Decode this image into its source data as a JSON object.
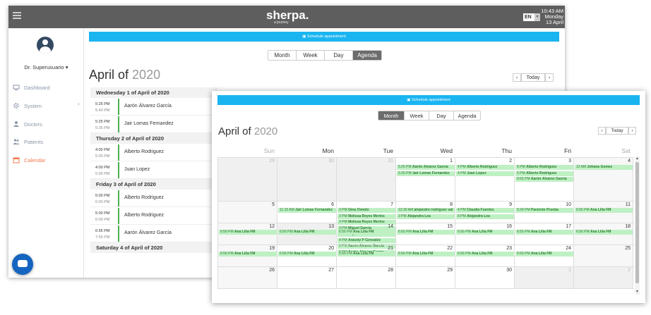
{
  "header": {
    "logo": "sherpa.",
    "logo_sub": "a journey",
    "language": "EN",
    "time": "10:43 AM",
    "weekday": "Monday",
    "date": "13 April"
  },
  "user": {
    "name": "Dr. Superusuario"
  },
  "sidebar": {
    "items": [
      {
        "label": "Dashboard",
        "icon": "monitor-icon"
      },
      {
        "label": "System",
        "icon": "gear-icon"
      },
      {
        "label": "Doctors",
        "icon": "user-icon"
      },
      {
        "label": "Patients",
        "icon": "users-icon"
      },
      {
        "label": "Calendar",
        "icon": "calendar-icon",
        "active": true
      }
    ]
  },
  "toolbar": {
    "schedule_label": "Schedule appointment",
    "views": [
      "Month",
      "Week",
      "Day",
      "Agenda"
    ],
    "today_label": "Today",
    "prev": "‹",
    "next": "›"
  },
  "back_window": {
    "selected_view": "Agenda",
    "title_month": "April of",
    "title_year": "2020",
    "agenda": [
      {
        "day": "Wednesday 1 of April of 2020",
        "rows": [
          {
            "start": "5:25 PM",
            "end": "5:40 PM",
            "name": "Aarón Álvarez García"
          },
          {
            "start": "5:25 PM",
            "end": "5:35 PM",
            "name": "Jair Lomas Fernandez"
          }
        ]
      },
      {
        "day": "Thursday 2 of April of 2020",
        "rows": [
          {
            "start": "4:00 PM",
            "end": "5:00 PM",
            "name": "Alberto Rodriguez"
          },
          {
            "start": "4:00 PM",
            "end": "5:00 PM",
            "name": "Juan Lopez"
          }
        ]
      },
      {
        "day": "Friday 3 of April of 2020",
        "rows": [
          {
            "start": "5:00 PM",
            "end": "6:00 PM",
            "name": "Alberto Rodriguez"
          },
          {
            "start": "5:00 PM",
            "end": "6:00 PM",
            "name": "Alberto Rodriguez"
          },
          {
            "start": "6:55 PM",
            "end": "7:55 PM",
            "name": "Aarón Álvarez García"
          }
        ]
      },
      {
        "day": "Saturday 4 of April of 2020",
        "rows": []
      }
    ]
  },
  "front_window": {
    "selected_view": "Month",
    "title_month": "April of",
    "title_year": "2020",
    "weekdays": [
      "Sun",
      "Mon",
      "Tue",
      "Wed",
      "Thu",
      "Fri",
      "Sat"
    ],
    "weeks": [
      {
        "days": [
          {
            "n": "29",
            "other": true,
            "events": []
          },
          {
            "n": "30",
            "other": true,
            "events": []
          },
          {
            "n": "31",
            "other": true,
            "events": []
          },
          {
            "n": "1",
            "events": [
              {
                "t": "5:25 PM",
                "name": "Aarón Álvarez García"
              },
              {
                "t": "5:25 PM",
                "name": "Jair Lomas Fernandez"
              }
            ]
          },
          {
            "n": "2",
            "events": [
              {
                "t": "4 PM",
                "name": "Alberto Rodriguez"
              },
              {
                "t": "4 PM",
                "name": "Juan Lopez"
              }
            ]
          },
          {
            "n": "3",
            "events": [
              {
                "t": "5 PM",
                "name": "Alberto Rodriguez"
              },
              {
                "t": "5 PM",
                "name": "Alberto Rodriguez"
              },
              {
                "t": "6:55 PM",
                "name": "Aarón Álvarez García"
              }
            ]
          },
          {
            "n": "4",
            "events": [
              {
                "t": "12 AM",
                "name": "Johana Gomez"
              }
            ]
          }
        ]
      },
      {
        "days": [
          {
            "n": "5",
            "events": []
          },
          {
            "n": "6",
            "events": [
              {
                "t": "11:15 AM",
                "name": "Jair Lomas Fernandez"
              }
            ]
          },
          {
            "n": "7",
            "events": [
              {
                "t": "3 PM",
                "name": "Gina Oviedo"
              },
              {
                "t": "3 PM",
                "name": "Melissa Reyes Merlos"
              },
              {
                "t": "3 PM",
                "name": "Melissa Reyes Merlos"
              },
              {
                "t": "3 PM",
                "name": "Miguel García"
              },
              {
                "t": "3 PM",
                "name": "Miguel García"
              },
              {
                "t": "4 PM",
                "name": "Aracely P Gonzalez"
              },
              {
                "t": "9 PM",
                "name": "Aarón Álvarez García"
              },
              {
                "t": "9 PM",
                "name": "Aarón Álvarez García"
              }
            ]
          },
          {
            "n": "8",
            "events": [
              {
                "t": "12:30 AM",
                "name": "alejandro rodriguez val"
              },
              {
                "t": "3 PM",
                "name": "Alejandra Lea"
              }
            ]
          },
          {
            "n": "9",
            "events": [
              {
                "t": "4 PM",
                "name": "Claudia Fuentes"
              },
              {
                "t": "8 PM",
                "name": "Alejandra Lea"
              }
            ]
          },
          {
            "n": "10",
            "events": [
              {
                "t": "5:34 PM",
                "name": "Paciente Prueba"
              }
            ]
          },
          {
            "n": "11",
            "events": [
              {
                "t": "6:56 PM",
                "name": "Ana Lilia FM"
              }
            ]
          }
        ]
      },
      {
        "days": [
          {
            "n": "12",
            "events": [
              {
                "t": "6:56 PM",
                "name": "Ana Lilia FM"
              }
            ]
          },
          {
            "n": "13",
            "today": true,
            "events": [
              {
                "t": "6:56 PM",
                "name": "Ana Lilia FM"
              }
            ]
          },
          {
            "n": "14",
            "events": [
              {
                "t": "6:56 PM",
                "name": "Ana Lilia FM"
              }
            ]
          },
          {
            "n": "15",
            "events": [
              {
                "t": "6:56 PM",
                "name": "Ana Lilia FM"
              }
            ]
          },
          {
            "n": "16",
            "events": [
              {
                "t": "6:56 PM",
                "name": "Ana Lilia FM"
              }
            ]
          },
          {
            "n": "17",
            "events": [
              {
                "t": "6:56 PM",
                "name": "Ana Lilia FM"
              }
            ]
          },
          {
            "n": "18",
            "events": [
              {
                "t": "6:56 PM",
                "name": "Ana Lilia FM"
              }
            ]
          }
        ]
      },
      {
        "days": [
          {
            "n": "19",
            "events": [
              {
                "t": "6:56 PM",
                "name": "Ana Lilia FM"
              }
            ]
          },
          {
            "n": "20",
            "events": [
              {
                "t": "6:56 PM",
                "name": "Ana Lilia FM"
              }
            ]
          },
          {
            "n": "21",
            "events": [
              {
                "t": "6:56 PM",
                "name": "Ana Lilia FM"
              }
            ]
          },
          {
            "n": "22",
            "events": [
              {
                "t": "6:56 PM",
                "name": "Ana Lilia FM"
              }
            ]
          },
          {
            "n": "23",
            "events": [
              {
                "t": "6:56 PM",
                "name": "Ana Lilia FM"
              }
            ]
          },
          {
            "n": "24",
            "events": [
              {
                "t": "6:56 PM",
                "name": "Ana Lilia FM"
              }
            ]
          },
          {
            "n": "25",
            "events": []
          }
        ]
      },
      {
        "days": [
          {
            "n": "26",
            "events": []
          },
          {
            "n": "27",
            "events": []
          },
          {
            "n": "28",
            "events": []
          },
          {
            "n": "29",
            "events": []
          },
          {
            "n": "30",
            "events": []
          },
          {
            "n": "1",
            "other": true,
            "events": []
          },
          {
            "n": "2",
            "other": true,
            "events": []
          }
        ]
      }
    ]
  },
  "colors": {
    "accent": "#1ab5f0",
    "event_bg": "#bff0c4",
    "event_text": "#2e7d32",
    "topbar": "#5e5e5e",
    "active_nav": "#f2784b",
    "chat": "#1565c0"
  }
}
